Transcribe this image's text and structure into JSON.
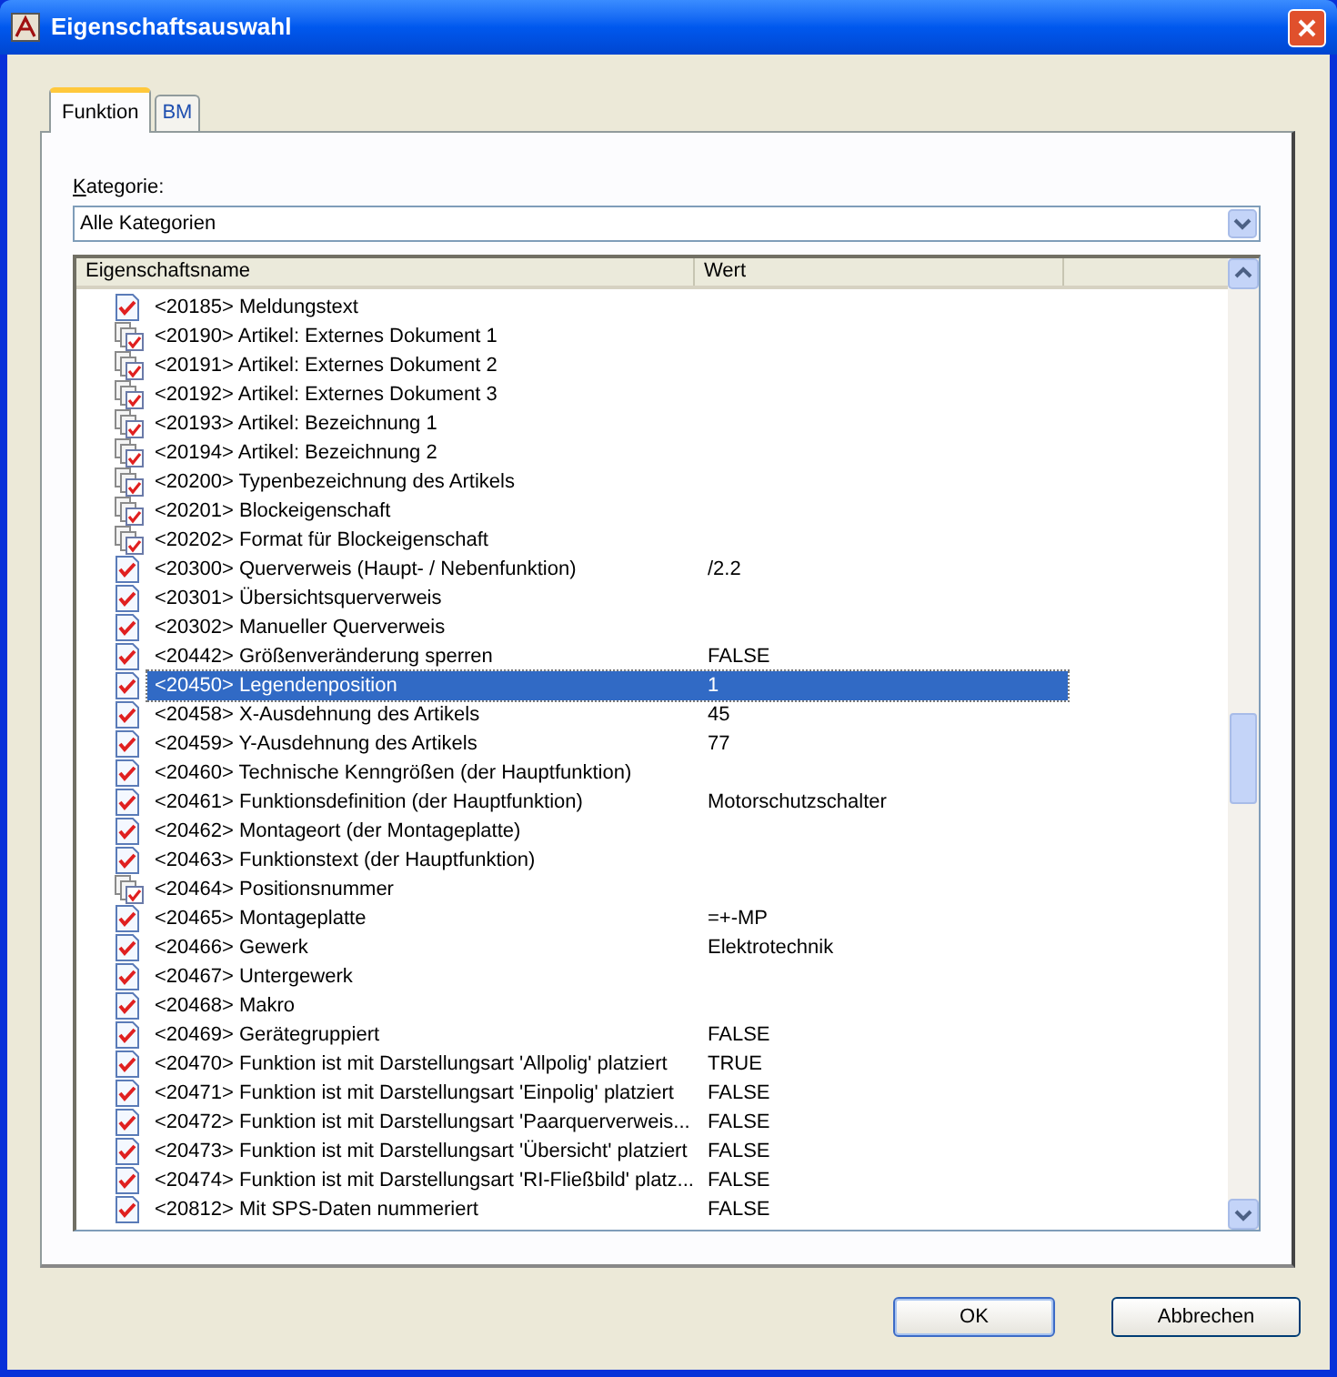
{
  "window": {
    "title": "Eigenschaftsauswahl"
  },
  "tabs": [
    {
      "label": "Funktion",
      "selected": true
    },
    {
      "label": "BM",
      "selected": false
    }
  ],
  "category": {
    "label": "Kategorie:",
    "value": "Alle Kategorien"
  },
  "table": {
    "columns": [
      "Eigenschaftsname",
      "Wert"
    ],
    "rows": [
      {
        "kind": "single",
        "name": "<20185> Meldungstext",
        "selected": false
      },
      {
        "kind": "multi",
        "name": "<20190> Artikel: Externes Dokument 1",
        "selected": false
      },
      {
        "kind": "multi",
        "name": "<20191> Artikel: Externes Dokument 2",
        "selected": false
      },
      {
        "kind": "multi",
        "name": "<20192> Artikel: Externes Dokument 3",
        "selected": false
      },
      {
        "kind": "multi",
        "name": "<20193> Artikel: Bezeichnung 1",
        "selected": false
      },
      {
        "kind": "multi",
        "name": "<20194> Artikel: Bezeichnung 2",
        "selected": false
      },
      {
        "kind": "multi",
        "name": "<20200> Typenbezeichnung des Artikels",
        "selected": false
      },
      {
        "kind": "multi",
        "name": "<20201> Blockeigenschaft",
        "selected": false
      },
      {
        "kind": "multi",
        "name": "<20202> Format für Blockeigenschaft",
        "selected": false
      },
      {
        "kind": "single",
        "name": "<20300> Querverweis (Haupt- / Nebenfunktion)",
        "value": "/2.2",
        "selected": false
      },
      {
        "kind": "single",
        "name": "<20301> Übersichtsquerverweis",
        "selected": false
      },
      {
        "kind": "single",
        "name": "<20302> Manueller Querverweis",
        "selected": false
      },
      {
        "kind": "single",
        "name": "<20442> Größenveränderung sperren",
        "value": "FALSE",
        "selected": false
      },
      {
        "kind": "single",
        "name": "<20450> Legendenposition",
        "value": "1",
        "selected": true
      },
      {
        "kind": "single",
        "name": "<20458> X-Ausdehnung des Artikels",
        "value": "45",
        "selected": false
      },
      {
        "kind": "single",
        "name": "<20459> Y-Ausdehnung des Artikels",
        "value": "77",
        "selected": false
      },
      {
        "kind": "single",
        "name": "<20460> Technische Kenngrößen (der Hauptfunktion)",
        "selected": false
      },
      {
        "kind": "single",
        "name": "<20461> Funktionsdefinition (der Hauptfunktion)",
        "value": "Motorschutzschalter",
        "selected": false
      },
      {
        "kind": "single",
        "name": "<20462> Montageort (der Montageplatte)",
        "selected": false
      },
      {
        "kind": "single",
        "name": "<20463> Funktionstext (der Hauptfunktion)",
        "selected": false
      },
      {
        "kind": "multi",
        "name": "<20464> Positionsnummer",
        "selected": false
      },
      {
        "kind": "single",
        "name": "<20465> Montageplatte",
        "value": "=+-MP",
        "selected": false
      },
      {
        "kind": "single",
        "name": "<20466> Gewerk",
        "value": "Elektrotechnik",
        "selected": false
      },
      {
        "kind": "single",
        "name": "<20467> Untergewerk",
        "selected": false
      },
      {
        "kind": "single",
        "name": "<20468> Makro",
        "selected": false
      },
      {
        "kind": "single",
        "name": "<20469> Gerätegruppiert",
        "value": "FALSE",
        "selected": false
      },
      {
        "kind": "single",
        "name": "<20470> Funktion ist mit Darstellungsart 'Allpolig' platziert",
        "value": "TRUE",
        "selected": false
      },
      {
        "kind": "single",
        "name": "<20471> Funktion ist mit Darstellungsart 'Einpolig' platziert",
        "value": "FALSE",
        "selected": false
      },
      {
        "kind": "single",
        "name": "<20472> Funktion ist mit Darstellungsart 'Paarquerverweis...",
        "value": "FALSE",
        "selected": false
      },
      {
        "kind": "single",
        "name": "<20473> Funktion ist mit Darstellungsart 'Übersicht' platziert",
        "value": "FALSE",
        "selected": false
      },
      {
        "kind": "single",
        "name": "<20474> Funktion ist mit Darstellungsart 'RI-Fließbild' platz...",
        "value": "FALSE",
        "selected": false
      },
      {
        "kind": "single",
        "name": "<20812> Mit SPS-Daten nummeriert",
        "value": "FALSE",
        "selected": false
      }
    ]
  },
  "buttons": [
    "OK",
    "Abbrechen"
  ]
}
